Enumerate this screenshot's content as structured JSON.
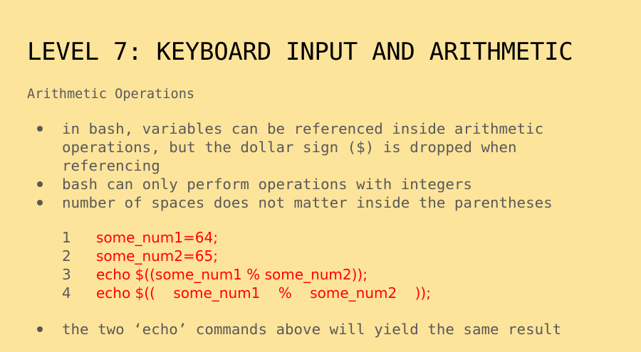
{
  "slide": {
    "title": "LEVEL 7: KEYBOARD INPUT AND ARITHMETIC",
    "subtitle": "Arithmetic Operations",
    "bullets": [
      "in bash, variables can be referenced inside arithmetic operations, but the dollar sign ($) is dropped when referencing",
      "bash can only perform operations with integers",
      "number of spaces does not matter inside the parentheses"
    ],
    "code": [
      {
        "num": "1",
        "text": "some_num1=64;"
      },
      {
        "num": "2",
        "text": "some_num2=65;"
      },
      {
        "num": "3",
        "text": "echo $((some_num1 % some_num2));"
      },
      {
        "num": "4",
        "text": "echo $((    some_num1    %    some_num2    ));"
      }
    ],
    "final_bullet": "the two ‘echo’ commands above will yield the same result"
  },
  "colors": {
    "background": "#fde49b",
    "title": "#000000",
    "body_text": "#595959",
    "code_text": "#ff0000"
  }
}
